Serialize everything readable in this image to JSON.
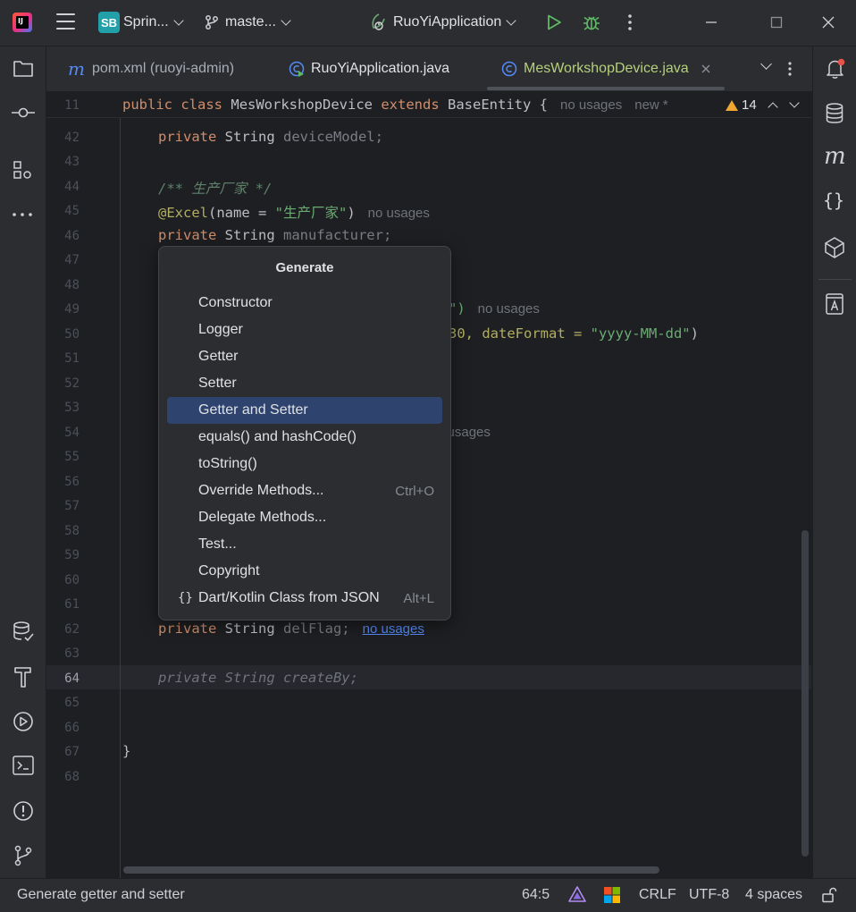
{
  "titlebar": {
    "project_badge": "SB",
    "project_name": "Sprin...",
    "branch": "maste...",
    "run_config": "RuoYiApplication"
  },
  "tabs": [
    {
      "label": "pom.xml (ruoyi-admin)"
    },
    {
      "label": "RuoYiApplication.java"
    },
    {
      "label": "MesWorkshopDevice.java"
    }
  ],
  "sticky": {
    "line": "11",
    "kw1": "public",
    "kw2": "class",
    "name": "MesWorkshopDevice",
    "kw3": "extends",
    "base": "BaseEntity {",
    "hint1": "no usages",
    "hint2": "new *",
    "warnings": "14"
  },
  "lines": {
    "l42": {
      "num": "42",
      "kw": "private",
      "rest": " String ",
      "field": "deviceModel;"
    },
    "l43": {
      "num": "43"
    },
    "l44": {
      "num": "44",
      "comment": "/** 生产厂家 */"
    },
    "l45": {
      "num": "45",
      "ann": "@Excel",
      "pre": "(name = ",
      "str": "\"生产厂家\"",
      "post": ")",
      "hint": "no usages"
    },
    "l46": {
      "num": "46",
      "kw": "private",
      "rest": " String ",
      "field": "manufacturer;"
    },
    "l47": {
      "num": "47"
    },
    "l48": {
      "num": "48"
    },
    "l49": {
      "num": "49",
      "str": "\")",
      "hint": "no usages"
    },
    "l50": {
      "num": "50",
      "pre": "30, dateFormat = ",
      "str": "\"yyyy-MM-dd\"",
      "post": ")"
    },
    "l51": {
      "num": "51"
    },
    "l52": {
      "num": "52"
    },
    "l53": {
      "num": "53"
    },
    "l54": {
      "num": "54",
      "hint": "o usages"
    },
    "l55": {
      "num": "55"
    },
    "l56": {
      "num": "56"
    },
    "l57": {
      "num": "57"
    },
    "l58": {
      "num": "58"
    },
    "l59": {
      "num": "59"
    },
    "l60": {
      "num": "60"
    },
    "l61": {
      "num": "61"
    },
    "l62": {
      "num": "62",
      "kw": "private",
      "rest": " String ",
      "field": "delFlag;",
      "hint": "no usages"
    },
    "l63": {
      "num": "63"
    },
    "l64": {
      "num": "64",
      "text": "private String createBy;"
    },
    "l65": {
      "num": "65"
    },
    "l66": {
      "num": "66"
    },
    "l67": {
      "num": "67",
      "text": "}"
    },
    "l68": {
      "num": "68"
    }
  },
  "popup": {
    "title": "Generate",
    "items": [
      {
        "label": "Constructor"
      },
      {
        "label": "Logger"
      },
      {
        "label": "Getter"
      },
      {
        "label": "Setter"
      },
      {
        "label": "Getter and Setter"
      },
      {
        "label": "equals() and hashCode()"
      },
      {
        "label": "toString()"
      },
      {
        "label": "Override Methods...",
        "shortcut": "Ctrl+O"
      },
      {
        "label": "Delegate Methods..."
      },
      {
        "label": "Test..."
      },
      {
        "label": "Copyright"
      },
      {
        "label": "Dart/Kotlin Class from JSON",
        "shortcut": "Alt+L",
        "icon": "{}"
      }
    ],
    "selected_index": 4
  },
  "statusbar": {
    "message": "Generate getter and setter",
    "position": "64:5",
    "line_sep": "CRLF",
    "encoding": "UTF-8",
    "indent": "4 spaces"
  },
  "colors": {
    "accent_selected": "#2e436e",
    "keyword": "#cf8e6d",
    "annotation": "#b3ae60",
    "string": "#6aab73",
    "link": "#548af7"
  }
}
